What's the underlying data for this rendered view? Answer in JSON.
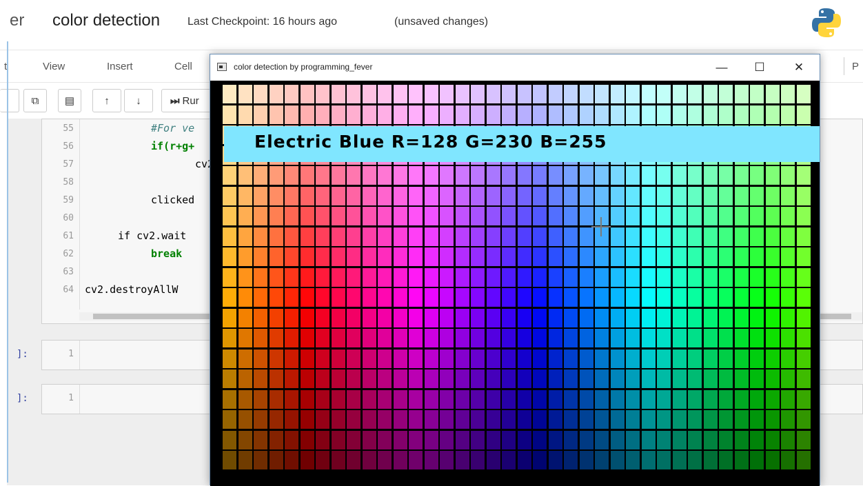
{
  "header": {
    "logo_fragment": "er",
    "notebook_title": "color detection",
    "checkpoint": "Last Checkpoint: 16 hours ago",
    "status": "(unsaved changes)",
    "logo_icon": "python-logo-icon"
  },
  "menu": {
    "items": [
      "t",
      "View",
      "Insert",
      "Cell"
    ],
    "right_fragment": "P"
  },
  "toolbar": {
    "copy_icon": "copy-icon",
    "paste_icon": "paste-icon",
    "up_icon": "arrow-up-icon",
    "down_icon": "arrow-down-icon",
    "run_label": "Rur",
    "run_icon": "step-forward-icon"
  },
  "code_cell": {
    "lines": [
      {
        "num": "55",
        "text": "#For ve"
      },
      {
        "num": "56",
        "text": "if(r+g+"
      },
      {
        "num": "57",
        "text": "cv2"
      },
      {
        "num": "58",
        "text": ""
      },
      {
        "num": "59",
        "text": "clicked"
      },
      {
        "num": "60",
        "text": ""
      },
      {
        "num": "61",
        "text": "if cv2.wait"
      },
      {
        "num": "62",
        "text": "break"
      },
      {
        "num": "63",
        "text": ""
      },
      {
        "num": "64",
        "text": "cv2.destroyAllW"
      }
    ]
  },
  "empty_cells": [
    {
      "prompt": "]:",
      "line": "1"
    },
    {
      "prompt": "]:",
      "line": "1"
    }
  ],
  "cv_window": {
    "title": "color detection by programming_fever",
    "minimize": "—",
    "maximize": "☐",
    "close": "✕",
    "banner": "Electric Blue R=128 G=230 B=255",
    "banner_color": "#80e6ff"
  }
}
